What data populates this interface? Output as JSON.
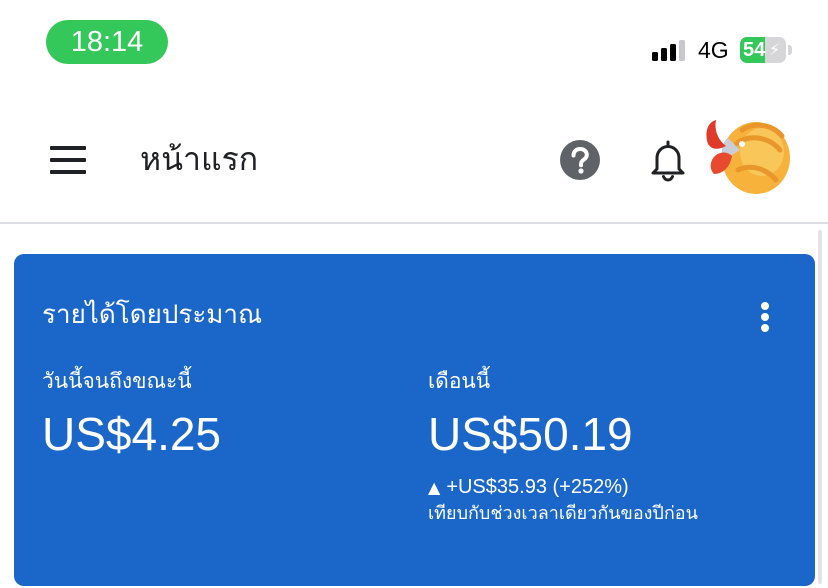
{
  "status_bar": {
    "time": "18:14",
    "network": "4G",
    "battery_level": "54",
    "battery_percent": 54,
    "charging": true
  },
  "app_bar": {
    "title": "หน้าแรก",
    "menu_icon": "hamburger-menu-icon",
    "help_icon": "help-circle-icon",
    "notifications_icon": "bell-icon",
    "avatar_icon": "shrimp-avatar-icon"
  },
  "earnings_card": {
    "title": "รายได้โดยประมาณ",
    "menu_icon": "more-vertical-icon",
    "today": {
      "label": "วันนี้จนถึงขณะนี้",
      "value": "US$4.25"
    },
    "month": {
      "label": "เดือนนี้",
      "value": "US$50.19",
      "change": "+US$35.93 (+252%)",
      "change_icon": "triangle-up-icon",
      "comparison": "เทียบกับช่วงเวลาเดียวกันของปีก่อน"
    }
  },
  "colors": {
    "card_background": "#1a66c9",
    "status_pill": "#34c759",
    "text_dark": "#202124",
    "icon_gray": "#5f6368"
  }
}
